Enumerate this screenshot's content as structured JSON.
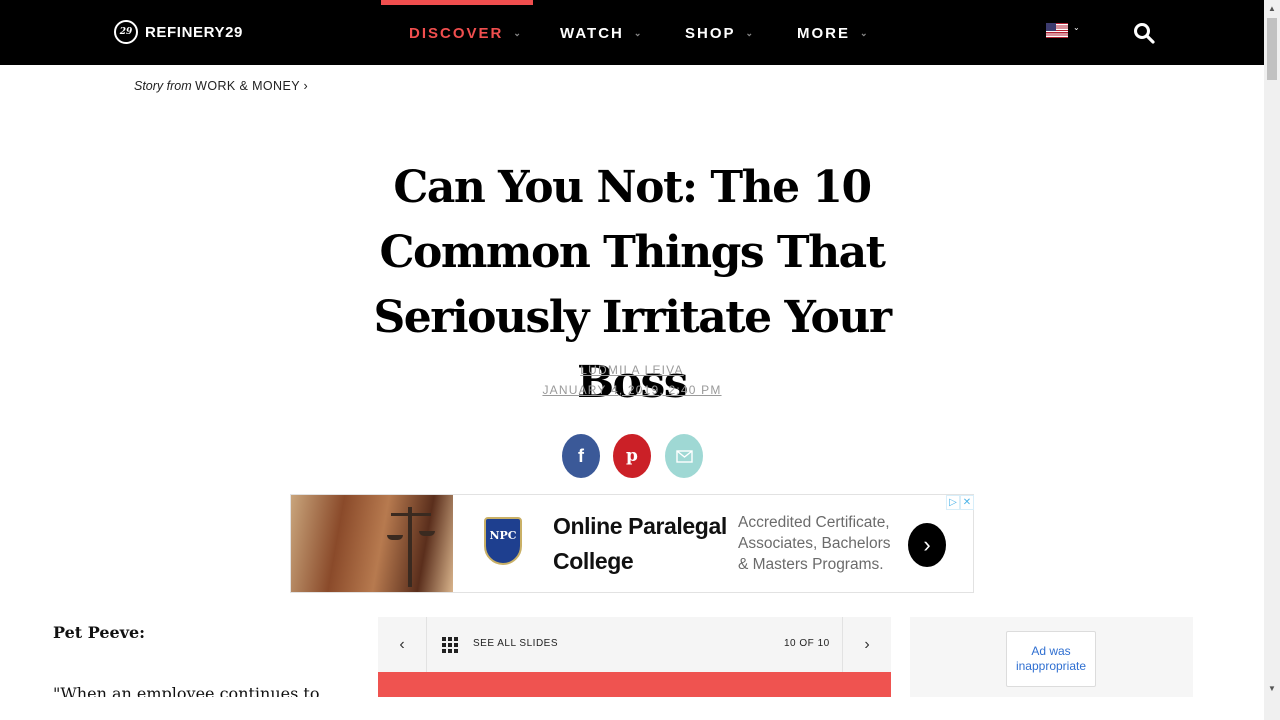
{
  "header": {
    "brand": "REFINERY29",
    "brand_mark": "29",
    "nav": [
      {
        "label": "DISCOVER",
        "active": true
      },
      {
        "label": "WATCH",
        "active": false
      },
      {
        "label": "SHOP",
        "active": false
      },
      {
        "label": "MORE",
        "active": false
      }
    ],
    "chevron": "⌄",
    "icons": {
      "region": "us-flag-icon",
      "search": "search-icon"
    },
    "accent_color": "#f04e4e"
  },
  "breadcrumb": {
    "prefix": "Story from",
    "section": "WORK & MONEY",
    "chevron": "›"
  },
  "article": {
    "title": "Can You Not: The 10 Common Things That Seriously Irritate Your Boss",
    "author": "LUDMILA LEIVA",
    "date": "JANUARY 4, 2019, 2:40 PM"
  },
  "share": [
    {
      "network": "facebook",
      "glyph": "f",
      "color": "#3b5998"
    },
    {
      "network": "pinterest",
      "glyph": "p",
      "color": "#cb2027"
    },
    {
      "network": "email",
      "glyph": "envelope-icon",
      "color": "#9fd8d4"
    }
  ],
  "ad_banner": {
    "logo_text": "NPC",
    "headline": "Online Paralegal College",
    "description": "Accredited Certificate, Associates, Bachelors & Masters Programs.",
    "arrow": "›",
    "choices": [
      "▷",
      "✕"
    ]
  },
  "content": {
    "pet_peeve_label": "Pet Peeve:",
    "quote": "\"When an employee continues to"
  },
  "slideshow": {
    "prev": "‹",
    "next": "›",
    "see_all": "SEE ALL SLIDES",
    "count": "10 OF 10"
  },
  "side_ad": {
    "report_label": "Ad was inappropriate"
  },
  "scrollbar": {
    "up": "▲",
    "down": "▼"
  }
}
